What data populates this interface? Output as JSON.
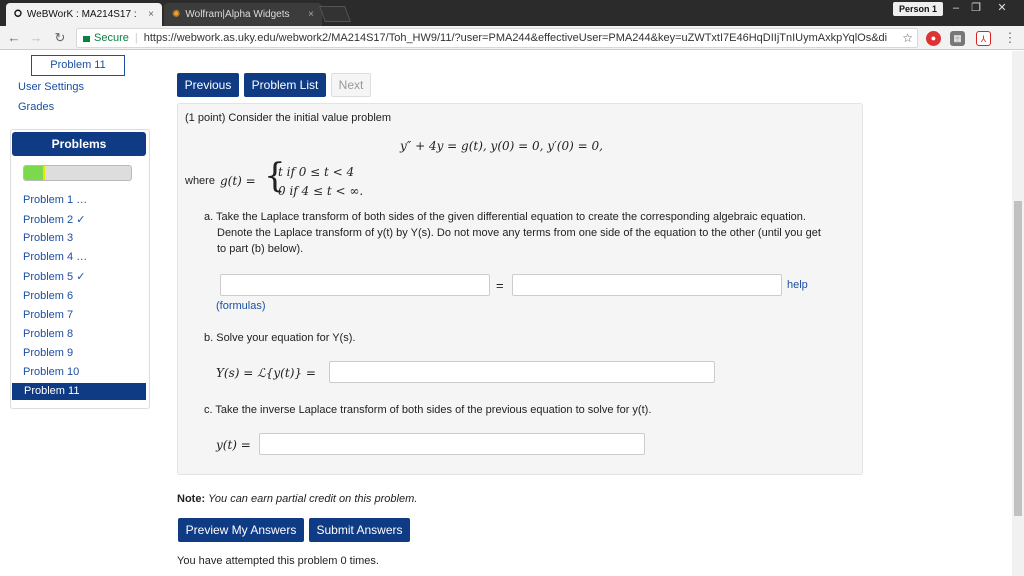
{
  "browser": {
    "tabs": [
      {
        "label": "WeBWorK : MA214S17 :",
        "icon": "webwork-icon"
      },
      {
        "label": "Wolfram|Alpha Widgets",
        "icon": "wolfram-icon"
      }
    ],
    "person": "Person 1",
    "secure": "Secure",
    "url_main": "https://webwork.as.uky.edu",
    "url_rest": "/webwork2/MA214S17/Toh_HW9/11/?user=PMA244&effectiveUser=PMA244&key=uZWTxtI7E46HqDIIjTnIUymAxkpYqlOs&di"
  },
  "sidebar": {
    "current_tab": "Problem 11",
    "links": [
      "User Settings",
      "Grades"
    ],
    "problems_title": "Problems",
    "progress_fraction": 0.2,
    "problems": [
      "Problem 1 …",
      "Problem 2 ✓",
      "Problem 3",
      "Problem 4 …",
      "Problem 5 ✓",
      "Problem 6",
      "Problem 7",
      "Problem 8",
      "Problem 9",
      "Problem 10",
      "Problem 11"
    ]
  },
  "nav": {
    "previous": "Previous",
    "problem_list": "Problem List",
    "next": "Next"
  },
  "problem": {
    "intro": "(1 point) Consider the initial value problem",
    "ivp": "y″ + 4y = g(t),        y(0) = 0,   y′(0) = 0,",
    "where": "where",
    "g_lhs": "g(t) =",
    "case1": "t     if 0 ≤ t < 4",
    "case2": "0     if 4 ≤ t < ∞.",
    "part_a_1": "a. Take the Laplace transform of both sides of the given differential equation to create the corresponding algebraic equation.",
    "part_a_2": "Denote the Laplace transform of y(t) by Y(s). Do not move any terms from one side of the equation to the other (until you get",
    "part_a_3": "to part (b) below).",
    "equals": "=",
    "help": "help",
    "formulas": "(formulas)",
    "part_b": "b. Solve your equation for Y(s).",
    "part_b_lhs": "Y(s) = ℒ{y(t)} =",
    "part_c": "c. Take the inverse Laplace transform of both sides of the previous equation to solve for y(t).",
    "part_c_lhs": "y(t) ="
  },
  "note": {
    "label": "Note:",
    "text": "You can earn partial credit on this problem."
  },
  "actions": {
    "preview": "Preview My Answers",
    "submit": "Submit Answers"
  },
  "attempts": "You have attempted this problem 0 times."
}
